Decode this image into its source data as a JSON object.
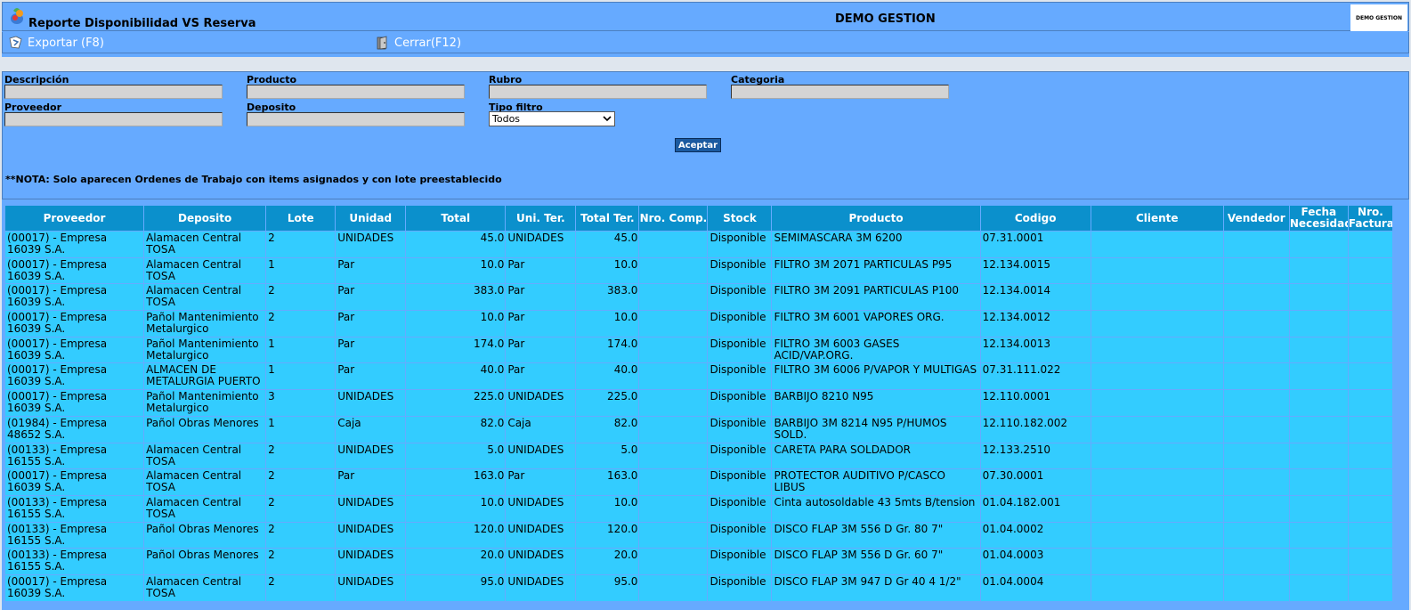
{
  "window": {
    "title": "Reporte Disponibilidad VS Reserva",
    "company": "DEMO GESTION",
    "corner_logo_text": "DEMO GESTION"
  },
  "toolbar": {
    "export_label": "Exportar (F8)",
    "close_label": "Cerrar(F12)"
  },
  "filters": {
    "descripcion_label": "Descripción",
    "producto_label": "Producto",
    "rubro_label": "Rubro",
    "categoria_label": "Categoria",
    "proveedor_label": "Proveedor",
    "deposito_label": "Deposito",
    "tipo_filtro_label": "Tipo filtro",
    "tipo_filtro_value": "Todos",
    "accept_label": "Aceptar",
    "note": "**NOTA: Solo aparecen Ordenes de Trabajo con items asignados y con lote preestablecido"
  },
  "table": {
    "headers": [
      "Proveedor",
      "Deposito",
      "Lote",
      "Unidad",
      "Total",
      "Uni. Ter.",
      "Total Ter.",
      "Nro. Comp.",
      "Stock",
      "Producto",
      "Codigo",
      "Cliente",
      "Vendedor",
      "Fecha Necesidad",
      "Nro. Factura"
    ],
    "rows": [
      [
        "(00017) - Empresa 16039 S.A.",
        "Alamacen Central TOSA",
        "2",
        "UNIDADES",
        "45.0",
        "UNIDADES",
        "45.0",
        "",
        "Disponible",
        "SEMIMASCARA 3M 6200",
        "07.31.0001",
        "",
        "",
        "",
        ""
      ],
      [
        "(00017) - Empresa 16039 S.A.",
        "Alamacen Central TOSA",
        "1",
        "Par",
        "10.0",
        "Par",
        "10.0",
        "",
        "Disponible",
        "FILTRO 3M 2071 PARTICULAS P95",
        "12.134.0015",
        "",
        "",
        "",
        ""
      ],
      [
        "(00017) - Empresa 16039 S.A.",
        "Alamacen Central TOSA",
        "2",
        "Par",
        "383.0",
        "Par",
        "383.0",
        "",
        "Disponible",
        "FILTRO 3M 2091 PARTICULAS P100",
        "12.134.0014",
        "",
        "",
        "",
        ""
      ],
      [
        "(00017) - Empresa 16039 S.A.",
        "Pañol Mantenimiento Metalurgico",
        "2",
        "Par",
        "10.0",
        "Par",
        "10.0",
        "",
        "Disponible",
        "FILTRO 3M 6001 VAPORES ORG.",
        "12.134.0012",
        "",
        "",
        "",
        ""
      ],
      [
        "(00017) - Empresa 16039 S.A.",
        "Pañol Mantenimiento Metalurgico",
        "1",
        "Par",
        "174.0",
        "Par",
        "174.0",
        "",
        "Disponible",
        "FILTRO 3M 6003 GASES ACID/VAP.ORG.",
        "12.134.0013",
        "",
        "",
        "",
        ""
      ],
      [
        "(00017) - Empresa 16039 S.A.",
        "ALMACEN DE METALURGIA PUERTO",
        "1",
        "Par",
        "40.0",
        "Par",
        "40.0",
        "",
        "Disponible",
        "FILTRO 3M 6006 P/VAPOR Y MULTIGAS",
        "07.31.111.022",
        "",
        "",
        "",
        ""
      ],
      [
        "(00017) - Empresa 16039 S.A.",
        "Pañol Mantenimiento Metalurgico",
        "3",
        "UNIDADES",
        "225.0",
        "UNIDADES",
        "225.0",
        "",
        "Disponible",
        "BARBIJO 8210 N95",
        "12.110.0001",
        "",
        "",
        "",
        ""
      ],
      [
        "(01984) - Empresa 48652 S.A.",
        "Pañol Obras Menores",
        "1",
        "Caja",
        "82.0",
        "Caja",
        "82.0",
        "",
        "Disponible",
        "BARBIJO 3M 8214 N95 P/HUMOS SOLD.",
        "12.110.182.002",
        "",
        "",
        "",
        ""
      ],
      [
        "(00133) - Empresa 16155 S.A.",
        "Alamacen Central TOSA",
        "2",
        "UNIDADES",
        "5.0",
        "UNIDADES",
        "5.0",
        "",
        "Disponible",
        "CARETA PARA SOLDADOR",
        "12.133.2510",
        "",
        "",
        "",
        ""
      ],
      [
        "(00017) - Empresa 16039 S.A.",
        "Alamacen Central TOSA",
        "2",
        "Par",
        "163.0",
        "Par",
        "163.0",
        "",
        "Disponible",
        "PROTECTOR AUDITIVO P/CASCO LIBUS",
        "07.30.0001",
        "",
        "",
        "",
        ""
      ],
      [
        "(00133) - Empresa 16155 S.A.",
        "Alamacen Central TOSA",
        "2",
        "UNIDADES",
        "10.0",
        "UNIDADES",
        "10.0",
        "",
        "Disponible",
        "Cinta autosoldable 43 5mts B/tension",
        "01.04.182.001",
        "",
        "",
        "",
        ""
      ],
      [
        "(00133) - Empresa 16155 S.A.",
        "Pañol Obras Menores",
        "2",
        "UNIDADES",
        "120.0",
        "UNIDADES",
        "120.0",
        "",
        "Disponible",
        "DISCO FLAP 3M 556 D Gr. 80 7\"",
        "01.04.0002",
        "",
        "",
        "",
        ""
      ],
      [
        "(00133) - Empresa 16155 S.A.",
        "Pañol Obras Menores",
        "2",
        "UNIDADES",
        "20.0",
        "UNIDADES",
        "20.0",
        "",
        "Disponible",
        "DISCO FLAP 3M 556 D Gr. 60 7\"",
        "01.04.0003",
        "",
        "",
        "",
        ""
      ],
      [
        "(00017) - Empresa 16039 S.A.",
        "Alamacen Central TOSA",
        "2",
        "UNIDADES",
        "95.0",
        "UNIDADES",
        "95.0",
        "",
        "Disponible",
        "DISCO FLAP 3M 947 D Gr 40 4 1/2\"",
        "01.04.0004",
        "",
        "",
        "",
        ""
      ]
    ]
  },
  "icons": {
    "app": "app-logo-icon",
    "export": "export-icon",
    "close": "close-door-icon"
  },
  "colors": {
    "background": "#66aaff",
    "header": "#0b90cc",
    "cell": "#33ccff",
    "button": "#1b5aa0"
  }
}
